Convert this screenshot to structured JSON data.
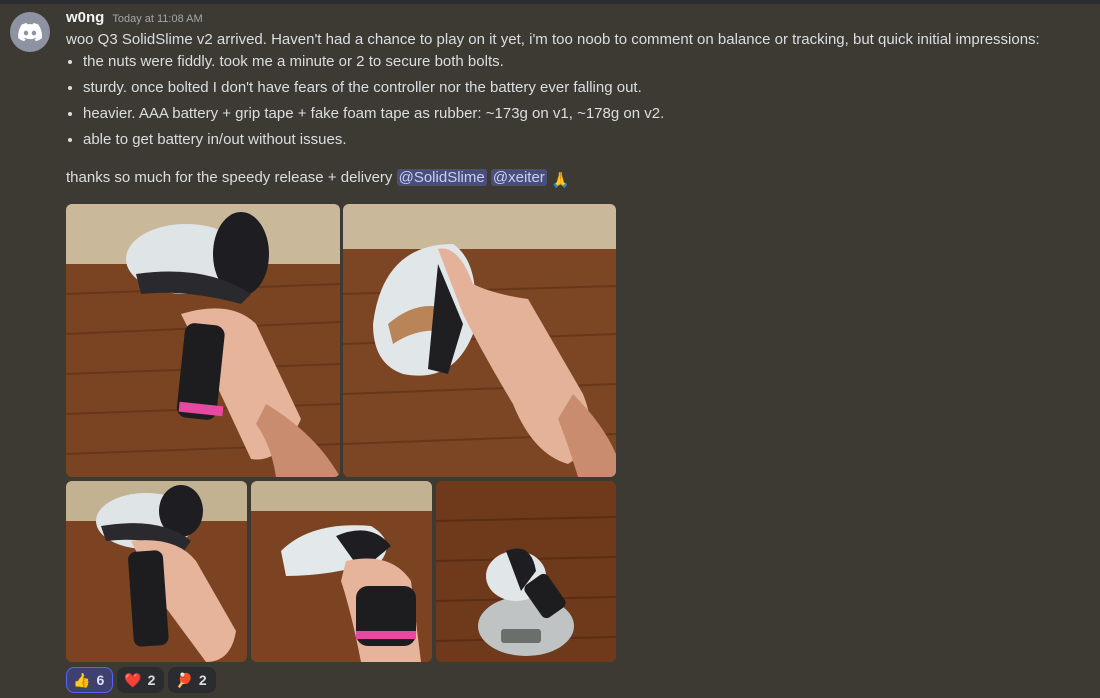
{
  "message": {
    "username": "w0ng",
    "timestamp": "Today at 11:08 AM",
    "intro": "woo Q3 SolidSlime v2 arrived. Haven't had a chance to play on it yet, i'm too noob to comment on balance or tracking, but quick initial impressions:",
    "bullets": [
      "the nuts were fiddly. took me a minute or 2 to secure both bolts.",
      "sturdy. once bolted I don't have fears of the controller nor the battery ever falling out.",
      "heavier. AAA battery + grip tape + fake foam tape as rubber: ~173g on v1, ~178g on v2.",
      "able to get battery in/out without issues."
    ],
    "closing": "thanks so much for the speedy release + delivery",
    "mentions": [
      "@SolidSlime",
      "@xeiter"
    ],
    "closing_emoji": "🙏"
  },
  "attachments": {
    "count": 5,
    "descriptions": [
      "controller-held-1",
      "controller-pointing",
      "controller-held-2",
      "controller-side",
      "controller-on-scale"
    ]
  },
  "reactions": [
    {
      "emoji": "👍",
      "count": "6",
      "me": true
    },
    {
      "emoji": "❤️",
      "count": "2",
      "me": false
    },
    {
      "emoji": "🏓",
      "count": "2",
      "me": false
    }
  ],
  "colors": {
    "background": "#3c3a33",
    "mention_bg": "#4a4f79",
    "reaction_bg": "#2b2c2f",
    "reaction_active_border": "#5865f2",
    "avatar_bg": "#8e93a4"
  }
}
